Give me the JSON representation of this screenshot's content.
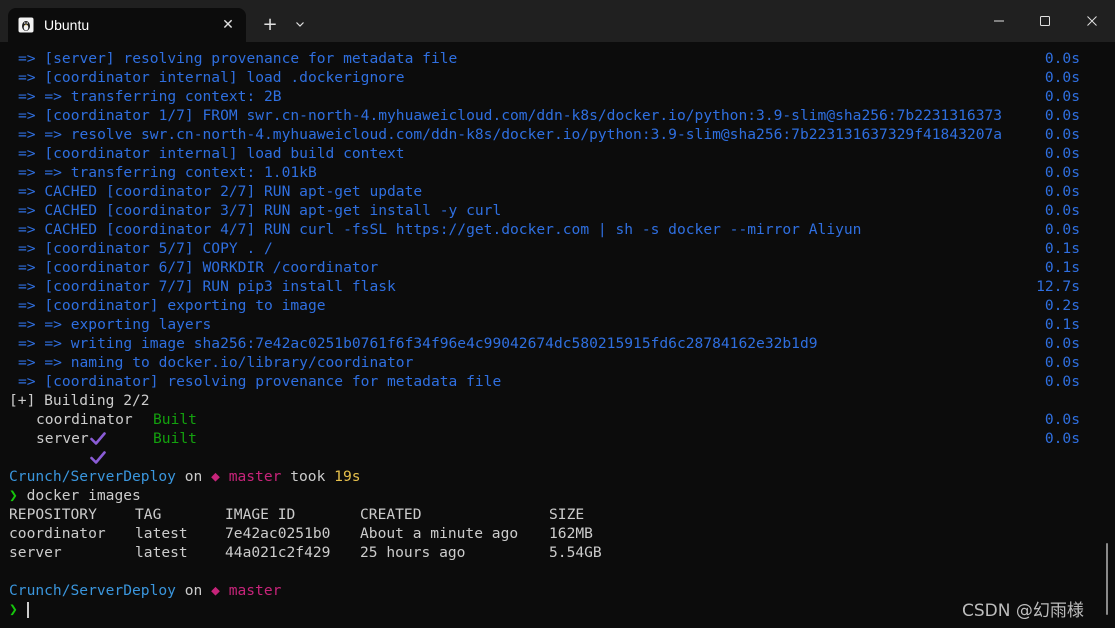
{
  "window": {
    "tab_title": "Ubuntu",
    "tab_icon": "linux-penguin-icon",
    "close_tab_symbol": "✕",
    "new_tab_symbol": "+"
  },
  "colors": {
    "background": "#0c0c0c",
    "titlebar": "#202020",
    "buildkit_blue": "#2f6fe0",
    "built_green": "#13a10e",
    "check_purple": "#8a5cd6",
    "path_cyan": "#3a96dd",
    "branch_magenta": "#c7247a",
    "duration_yellow": "#e6c04c",
    "prompt_green": "#16c60c"
  },
  "build_log": [
    {
      "text": "=> [server] resolving provenance for metadata file",
      "time": "0.0s"
    },
    {
      "text": "=> [coordinator internal] load .dockerignore",
      "time": "0.0s"
    },
    {
      "text": "=> => transferring context: 2B",
      "time": "0.0s"
    },
    {
      "text": "=> [coordinator 1/7] FROM swr.cn-north-4.myhuaweicloud.com/ddn-k8s/docker.io/python:3.9-slim@sha256:7b2231316373",
      "time": "0.0s"
    },
    {
      "text": "=> => resolve swr.cn-north-4.myhuaweicloud.com/ddn-k8s/docker.io/python:3.9-slim@sha256:7b223131637329f41843207a",
      "time": "0.0s"
    },
    {
      "text": "=> [coordinator internal] load build context",
      "time": "0.0s"
    },
    {
      "text": "=> => transferring context: 1.01kB",
      "time": "0.0s"
    },
    {
      "text": "=> CACHED [coordinator 2/7] RUN apt-get update",
      "time": "0.0s"
    },
    {
      "text": "=> CACHED [coordinator 3/7] RUN apt-get install -y curl",
      "time": "0.0s"
    },
    {
      "text": "=> CACHED [coordinator 4/7] RUN curl -fsSL https://get.docker.com | sh -s docker --mirror Aliyun",
      "time": "0.0s"
    },
    {
      "text": "=> [coordinator 5/7] COPY . /",
      "time": "0.1s"
    },
    {
      "text": "=> [coordinator 6/7] WORKDIR /coordinator",
      "time": "0.1s"
    },
    {
      "text": "=> [coordinator 7/7] RUN pip3 install flask",
      "time": "12.7s"
    },
    {
      "text": "=> [coordinator] exporting to image",
      "time": "0.2s"
    },
    {
      "text": "=> => exporting layers",
      "time": "0.1s"
    },
    {
      "text": "=> => writing image sha256:7e42ac0251b0761f6f34f96e4c99042674dc580215915fd6c28784162e32b1d9",
      "time": "0.0s"
    },
    {
      "text": "=> => naming to docker.io/library/coordinator",
      "time": "0.0s"
    },
    {
      "text": "=> [coordinator] resolving provenance for metadata file",
      "time": "0.0s"
    }
  ],
  "building_status": "[+] Building 2/2",
  "services": [
    {
      "name": "coordinator",
      "status": "Built",
      "time": "0.0s"
    },
    {
      "name": "server",
      "status": "Built",
      "time": "0.0s"
    }
  ],
  "prompt1": {
    "path": "Crunch/ServerDeploy",
    "on": "on",
    "branch_symbol": "◆",
    "branch": "master",
    "took": "took",
    "duration": "19s"
  },
  "command": {
    "chevron": "❯",
    "text": "docker images"
  },
  "images_table": {
    "headers": [
      "REPOSITORY",
      "TAG",
      "IMAGE ID",
      "CREATED",
      "SIZE"
    ],
    "rows": [
      [
        "coordinator",
        "latest",
        "7e42ac0251b0",
        "About a minute ago",
        "162MB"
      ],
      [
        "server",
        "latest",
        "44a021c2f429",
        "25 hours ago",
        "5.54GB"
      ]
    ]
  },
  "prompt2": {
    "path": "Crunch/ServerDeploy",
    "on": "on",
    "branch_symbol": "◆",
    "branch": "master"
  },
  "current_prompt": {
    "chevron": "❯"
  },
  "watermark": "CSDN @幻雨様"
}
